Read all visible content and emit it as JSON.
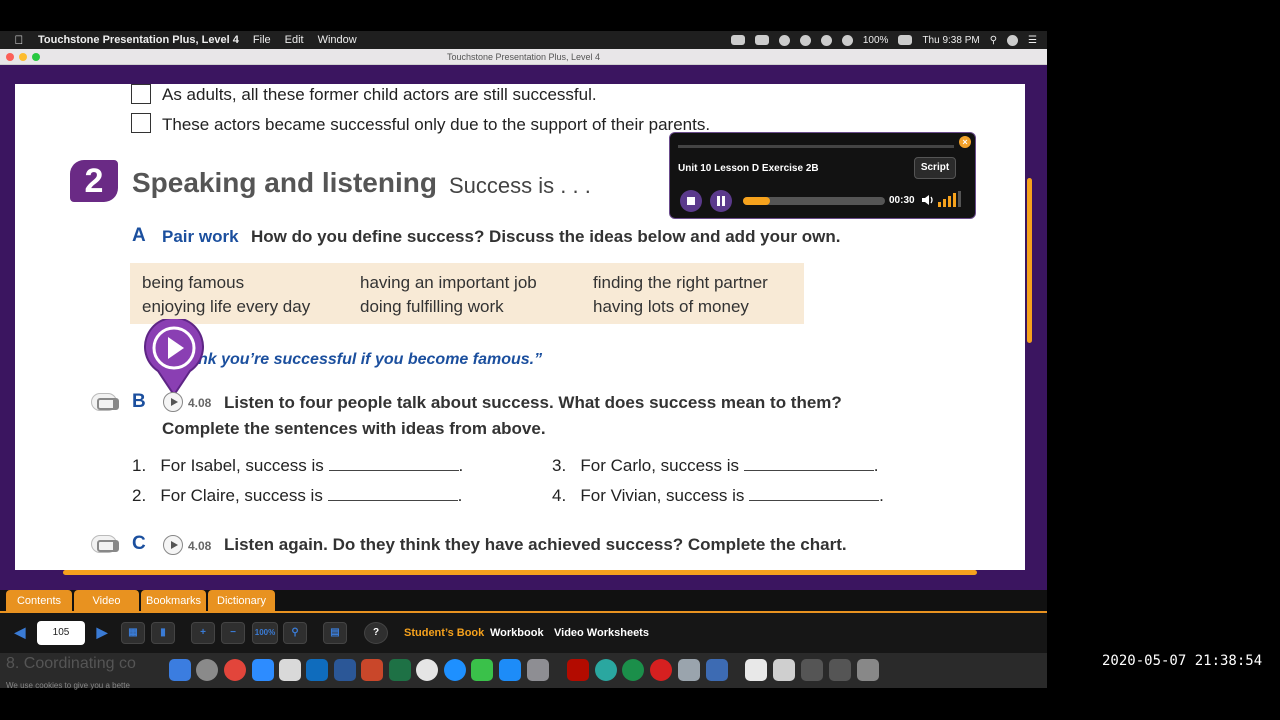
{
  "menubar": {
    "app_name": "Touchstone Presentation Plus, Level 4",
    "menus": [
      "File",
      "Edit",
      "Window"
    ],
    "battery": "100%",
    "clock": "Thu 9:38 PM"
  },
  "window": {
    "title": "Touchstone Presentation Plus, Level 4"
  },
  "page": {
    "checkbox_items": [
      "As adults, all these former child actors are still successful.",
      "These actors became successful only due to the support of their parents."
    ],
    "section_number": "2",
    "section_title": "Speaking and listening",
    "section_subtitle": "Success is . . .",
    "part_a": {
      "letter": "A",
      "label": "Pair work",
      "instruction": "How do you define success? Discuss the ideas below and add your own."
    },
    "word_box": [
      [
        "being famous",
        "having an important job",
        "finding the right partner"
      ],
      [
        "enjoying life every day",
        "doing fulfilling work",
        "having lots of money"
      ]
    ],
    "example_quote": "nk you’re successful if you become famous.”",
    "part_b": {
      "letter": "B",
      "track": "4.08",
      "instruction_line1": "Listen to four people talk about success. What does success mean to them?",
      "instruction_line2": "Complete the sentences with ideas from above."
    },
    "sentences": [
      {
        "num": "1.",
        "text": "For Isabel, success is"
      },
      {
        "num": "2.",
        "text": "For Claire, success is"
      },
      {
        "num": "3.",
        "text": "For Carlo, success is"
      },
      {
        "num": "4.",
        "text": "For Vivian, success is"
      }
    ],
    "part_c": {
      "letter": "C",
      "track": "4.08",
      "instruction": "Listen again. Do they think they have achieved success? Complete the chart."
    }
  },
  "player": {
    "title": "Unit 10 Lesson D Exercise 2B",
    "script_label": "Script",
    "time": "00:30",
    "progress": 0.19
  },
  "tabs": [
    "Contents",
    "Video",
    "Bookmarks",
    "Dictionary"
  ],
  "toolbar": {
    "page_number": "105",
    "zoom_label": "100%",
    "links": [
      "Student’s Book",
      "Workbook",
      "Video Worksheets"
    ]
  },
  "dock": {
    "behind_text": "8. Coordinating co",
    "cookie_text": "We use cookies to give you a bette"
  },
  "timestamp": "2020-05-07 21:38:54",
  "colors": {
    "accent_orange": "#f6a21d",
    "app_purple": "#3b1560",
    "heading_blue": "#1b4f9e"
  }
}
